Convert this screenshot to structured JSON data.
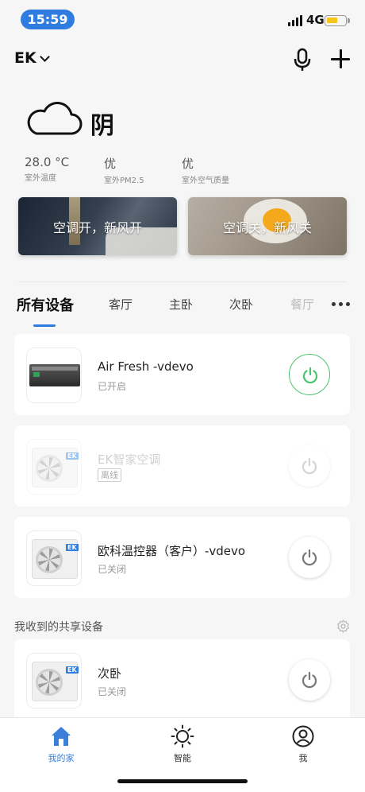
{
  "status_bar": {
    "time": "15:59",
    "network": "4G"
  },
  "header": {
    "home_name": "EK"
  },
  "weather": {
    "condition": "阴",
    "stats": [
      {
        "value": "28.0 °C",
        "label": "室外温度"
      },
      {
        "value": "优",
        "label": "室外PM2.5"
      },
      {
        "value": "优",
        "label": "室外空气质量"
      }
    ]
  },
  "scenes": [
    {
      "label": "空调开，新风开"
    },
    {
      "label": "空调关，新风关"
    }
  ],
  "tabs": [
    {
      "label": "所有设备"
    },
    {
      "label": "客厅"
    },
    {
      "label": "主卧"
    },
    {
      "label": "次卧"
    },
    {
      "label": "餐厅"
    }
  ],
  "devices": [
    {
      "name": "Air Fresh -vdevo",
      "status": "已开启"
    },
    {
      "name": "EK智家空调",
      "status": "离线"
    },
    {
      "name": "欧科温控器（客户）-vdevo",
      "status": "已关闭"
    }
  ],
  "shared": {
    "title": "我收到的共享设备",
    "devices": [
      {
        "name": "次卧",
        "status": "已关闭"
      }
    ]
  },
  "ac_logo": "EK",
  "bottom_nav": [
    {
      "label": "我的家"
    },
    {
      "label": "智能"
    },
    {
      "label": "我"
    }
  ],
  "colors": {
    "accent": "#2f7ce0",
    "power_on": "#4cc36e"
  },
  "icons": [
    "cloud-icon",
    "mic-icon",
    "plus-icon",
    "power-icon",
    "gear-icon",
    "home-icon",
    "sun-icon",
    "profile-icon",
    "more-icon"
  ]
}
